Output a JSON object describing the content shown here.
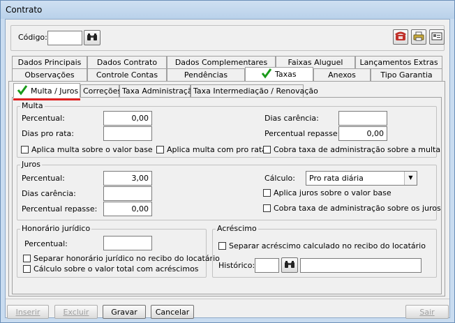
{
  "window": {
    "title": "Contrato"
  },
  "header": {
    "codigo_label": "Código:",
    "codigo_value": ""
  },
  "tabs_row1": [
    {
      "label": "Dados Principais"
    },
    {
      "label": "Dados Contrato"
    },
    {
      "label": "Dados Complementares"
    },
    {
      "label": "Faixas Aluguel"
    },
    {
      "label": "Lançamentos Extras"
    }
  ],
  "tabs_row2": [
    {
      "label": "Observações"
    },
    {
      "label": "Controle Contas"
    },
    {
      "label": "Pendências"
    },
    {
      "label": "Taxas"
    },
    {
      "label": "Anexos"
    },
    {
      "label": "Tipo Garantia"
    }
  ],
  "subtabs": [
    {
      "label": "Multa / Juros"
    },
    {
      "label": "Correções"
    },
    {
      "label": "Taxa Administração"
    },
    {
      "label": "Taxa Intermediação / Renovação"
    }
  ],
  "multa": {
    "title": "Multa",
    "percentual_label": "Percentual:",
    "percentual_value": "0,00",
    "dias_pro_rata_label": "Dias pro rata:",
    "dias_pro_rata_value": "",
    "dias_carencia_label": "Dias carência:",
    "dias_carencia_value": "",
    "percentual_repasse_label": "Percentual repasse:",
    "percentual_repasse_value": "0,00",
    "chk_valor_base": "Aplica multa sobre o valor base",
    "chk_pro_rata": "Aplica multa com pro rata",
    "chk_taxa_adm": "Cobra taxa de administração sobre a multa"
  },
  "juros": {
    "title": "Juros",
    "percentual_label": "Percentual:",
    "percentual_value": "3,00",
    "dias_carencia_label": "Dias carência:",
    "dias_carencia_value": "",
    "percentual_repasse_label": "Percentual repasse:",
    "percentual_repasse_value": "0,00",
    "calculo_label": "Cálculo:",
    "calculo_value": "Pro rata diária",
    "chk_valor_base": "Aplica juros sobre o valor base",
    "chk_taxa_adm": "Cobra taxa de administração sobre os juros"
  },
  "honorario": {
    "title": "Honorário jurídico",
    "percentual_label": "Percentual:",
    "percentual_value": "",
    "chk_separar": "Separar honorário jurídico no recibo do locatário",
    "chk_calculo": "Cálculo sobre o valor total com acréscimos"
  },
  "acrescimo": {
    "title": "Acréscimo",
    "chk_separar": "Separar acréscimo calculado no recibo do locatário",
    "historico_label": "Histórico:",
    "historico_code": "",
    "historico_desc": ""
  },
  "footer": {
    "inserir": "Inserir",
    "excluir": "Excluir",
    "gravar": "Gravar",
    "cancelar": "Cancelar",
    "sair": "Sair"
  },
  "colors": {
    "accent_underline": "#e02020",
    "check_green": "#1a9a1a"
  }
}
